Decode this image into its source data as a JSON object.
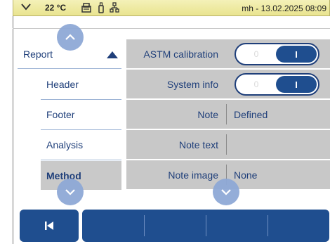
{
  "statusbar": {
    "temperature": "22 °C",
    "user_datetime": "mh - 13.02.2025 08:09",
    "icons": [
      "chevron-down-icon",
      "printer-icon",
      "bottle-icon",
      "network-icon"
    ]
  },
  "nav": {
    "section_label": "Report",
    "items": [
      {
        "label": "Header"
      },
      {
        "label": "Footer"
      },
      {
        "label": "Analysis"
      },
      {
        "label": "Method"
      }
    ],
    "selected": "Method"
  },
  "settings": {
    "rows": [
      {
        "label": "ASTM calibration",
        "toggle_off": "0",
        "toggle_on": "I"
      },
      {
        "label": "System info",
        "toggle_off": "0",
        "toggle_on": "I"
      },
      {
        "label": "Note",
        "value": "Defined"
      },
      {
        "label": "Note text",
        "value": ""
      },
      {
        "label": "Note image",
        "value": "None"
      }
    ]
  },
  "colors": {
    "accent": "#1f4e8f",
    "statusbar": "#efeaa6",
    "row_bg": "#c8c8c8",
    "scroll_button": "#8fa9d6"
  }
}
